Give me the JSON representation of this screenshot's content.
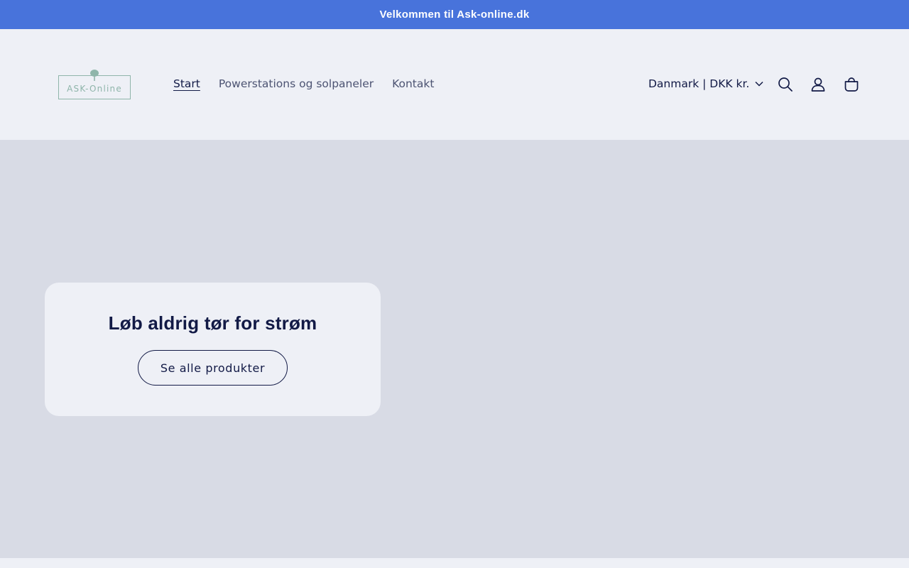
{
  "announcement": {
    "text": "Velkommen til Ask-online.dk"
  },
  "header": {
    "logo_text": "ASK-Online",
    "nav": [
      {
        "label": "Start",
        "active": true
      },
      {
        "label": "Powerstations og solpaneler",
        "active": false
      },
      {
        "label": "Kontakt",
        "active": false
      }
    ],
    "country_selector": "Danmark | DKK kr.",
    "icons": [
      "search-icon",
      "account-icon",
      "cart-icon"
    ]
  },
  "hero": {
    "heading": "Løb aldrig tør for strøm",
    "button_label": "Se alle produkter"
  },
  "colors": {
    "announcement_bg": "#4873db",
    "header_bg": "#eef0f6",
    "hero_bg": "#d8dbe5",
    "text_primary": "#121a46",
    "text_secondary": "#4c5372",
    "logo": "#8fb5aa"
  }
}
